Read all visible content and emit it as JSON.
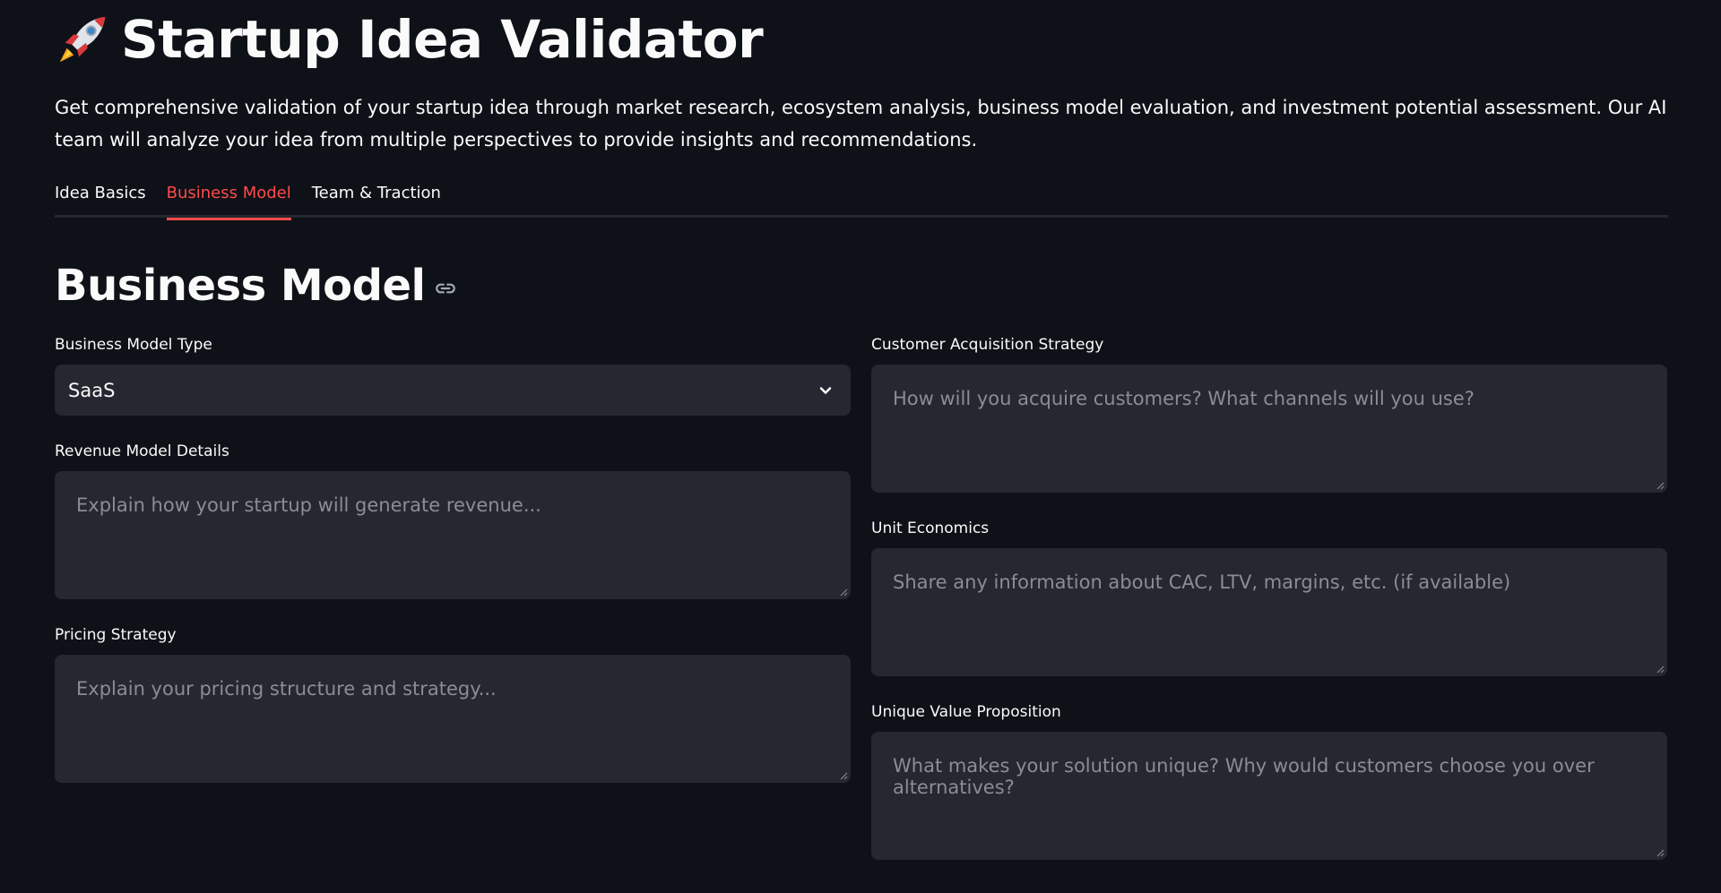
{
  "header": {
    "icon": "rocket-icon",
    "title": "Startup Idea Validator",
    "description": "Get comprehensive validation of your startup idea through market research, ecosystem analysis, business model evaluation, and investment potential assessment. Our AI team will analyze your idea from multiple perspectives to provide insights and recommendations."
  },
  "tabs": [
    {
      "label": "Idea Basics",
      "active": false
    },
    {
      "label": "Business Model",
      "active": true
    },
    {
      "label": "Team & Traction",
      "active": false
    }
  ],
  "section": {
    "title": "Business Model",
    "link_icon": "link-icon"
  },
  "left_fields": {
    "business_model_type": {
      "label": "Business Model Type",
      "value": "SaaS"
    },
    "revenue_model": {
      "label": "Revenue Model Details",
      "placeholder": "Explain how your startup will generate revenue..."
    },
    "pricing_strategy": {
      "label": "Pricing Strategy",
      "placeholder": "Explain your pricing structure and strategy..."
    }
  },
  "right_fields": {
    "customer_acquisition": {
      "label": "Customer Acquisition Strategy",
      "placeholder": "How will you acquire customers? What channels will you use?"
    },
    "unit_economics": {
      "label": "Unit Economics",
      "placeholder": "Share any information about CAC, LTV, margins, etc. (if available)"
    },
    "unique_value": {
      "label": "Unique Value Proposition",
      "placeholder": "What makes your solution unique? Why would customers choose you over alternatives?"
    }
  },
  "colors": {
    "background": "#0e1117",
    "input_background": "#262730",
    "accent": "#ff4b4b",
    "placeholder": "#8a8d96"
  }
}
